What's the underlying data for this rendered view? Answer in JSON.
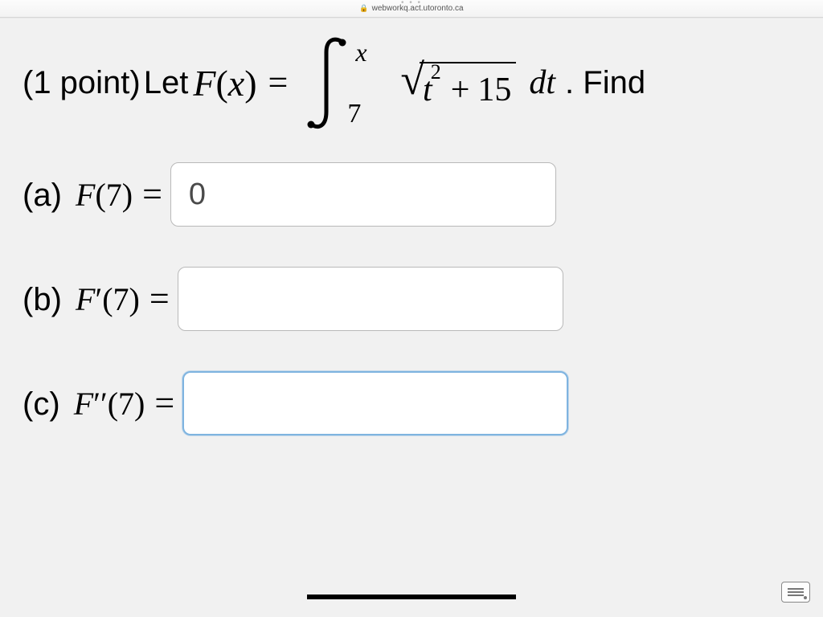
{
  "browser": {
    "url": "webworkq.act.utoronto.ca"
  },
  "problem": {
    "points_prefix": "(1 point) ",
    "let_text": "Let ",
    "function_name": "F",
    "function_var": "x",
    "equals": "=",
    "integral": {
      "lower": "7",
      "upper": "x",
      "radicand_var": "t",
      "radicand_power": "2",
      "radicand_plus": "+",
      "radicand_const": "15",
      "differential": "dt"
    },
    "find_text": ". Find"
  },
  "parts": {
    "a": {
      "label": "(a) ",
      "func": "F",
      "arg": "7",
      "eq": "=",
      "value": "0",
      "placeholder": ""
    },
    "b": {
      "label": "(b) ",
      "func": "F",
      "prime": "′",
      "arg": "7",
      "eq": "=",
      "value": "",
      "placeholder": ""
    },
    "c": {
      "label": "(c) ",
      "func": "F",
      "prime": "′′",
      "arg": "7",
      "eq": "=",
      "value": "",
      "placeholder": ""
    }
  }
}
